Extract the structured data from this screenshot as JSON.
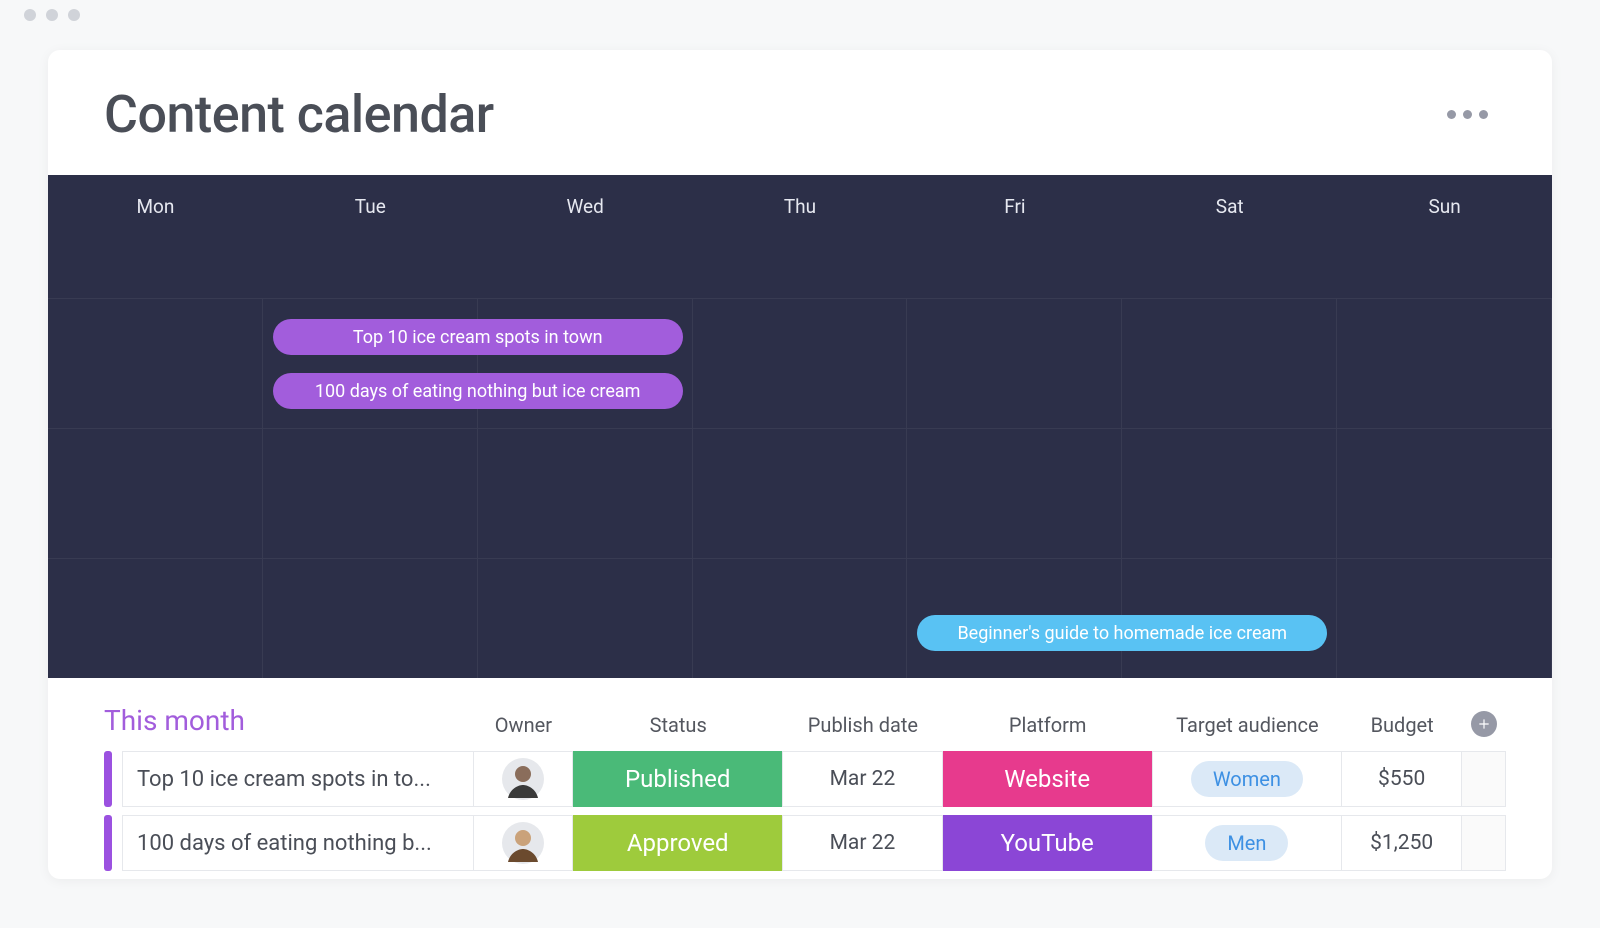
{
  "header": {
    "title": "Content calendar"
  },
  "calendar": {
    "days": [
      "Mon",
      "Tue",
      "Wed",
      "Thu",
      "Fri",
      "Sat",
      "Sun"
    ],
    "events": [
      {
        "label": "Top 10 ice cream spots in town",
        "color": "purple",
        "row": 0,
        "placement": "ev1"
      },
      {
        "label": "100 days of eating nothing but ice cream",
        "color": "purple",
        "row": 0,
        "placement": "ev2"
      },
      {
        "label": "Beginner's guide to homemade ice cream",
        "color": "blue",
        "row": 2,
        "placement": "ev3"
      }
    ]
  },
  "section": {
    "title": "This month",
    "columns": {
      "owner": "Owner",
      "status": "Status",
      "publish_date": "Publish date",
      "platform": "Platform",
      "target_audience": "Target audience",
      "budget": "Budget"
    },
    "rows": [
      {
        "item": "Top 10 ice cream spots in to...",
        "status": {
          "label": "Published",
          "class": "bg-published"
        },
        "publish_date": "Mar 22",
        "platform": {
          "label": "Website",
          "class": "bg-website"
        },
        "audience": "Women",
        "budget": "$550"
      },
      {
        "item": "100 days of eating nothing b...",
        "status": {
          "label": "Approved",
          "class": "bg-approved"
        },
        "publish_date": "Mar 22",
        "platform": {
          "label": "YouTube",
          "class": "bg-youtube"
        },
        "audience": "Men",
        "budget": "$1,250"
      }
    ]
  },
  "colors": {
    "accent_purple": "#a25ddc",
    "accent_blue": "#59c2f3",
    "status_published": "#4aba78",
    "status_approved": "#9ecb3c",
    "platform_website": "#e73a8d",
    "platform_youtube": "#8b46d6"
  }
}
